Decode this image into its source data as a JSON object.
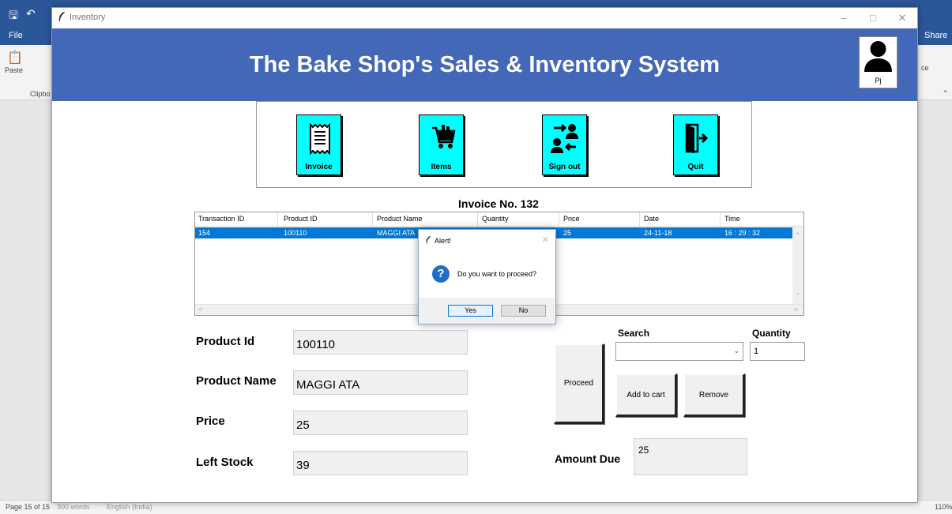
{
  "word": {
    "tabs": {
      "file": "File",
      "share": "Share"
    },
    "ribbon": {
      "paste": "Paste",
      "clipboard": "Clipbo",
      "fragment_right": "ce"
    },
    "statusbar": {
      "page": "Page 15 of 15",
      "words": "300 words",
      "language": "English (India)",
      "zoom": "110%"
    }
  },
  "window": {
    "title": "Inventory",
    "header_title": "The Bake Shop's Sales & Inventory System",
    "user_initials": "Pj"
  },
  "toolbar": {
    "invoice": "Invoice",
    "items": "Items",
    "signout": "Sign out",
    "quit": "Quit"
  },
  "invoice_title": "Invoice No. 132",
  "table": {
    "columns": [
      "Transaction ID",
      "Product ID",
      "Product Name",
      "Quantity",
      "Price",
      "Date",
      "Time"
    ],
    "rows": [
      [
        "154",
        "100110",
        "MAGGI ATA",
        "",
        "25",
        "24-11-18",
        "16 : 29 : 32"
      ]
    ]
  },
  "form": {
    "product_id_label": "Product Id",
    "product_id_value": "100110",
    "product_name_label": "Product Name",
    "product_name_value": "MAGGI ATA",
    "price_label": "Price",
    "price_value": "25",
    "left_stock_label": "Left Stock",
    "left_stock_value": "39"
  },
  "actions": {
    "search_label": "Search",
    "search_value": "",
    "quantity_label": "Quantity",
    "quantity_value": "1",
    "proceed": "Proceed",
    "add_to_cart": "Add to cart",
    "remove": "Remove",
    "amount_due_label": "Amount Due",
    "amount_due_value": "25"
  },
  "alert": {
    "title": "Alert!",
    "message": "Do you want to proceed?",
    "yes": "Yes",
    "no": "No"
  },
  "colors": {
    "header_bg": "#4468b8",
    "tool_button_bg": "#00ffff",
    "selected_row": "#0078d7",
    "word_blue": "#2b579a"
  }
}
